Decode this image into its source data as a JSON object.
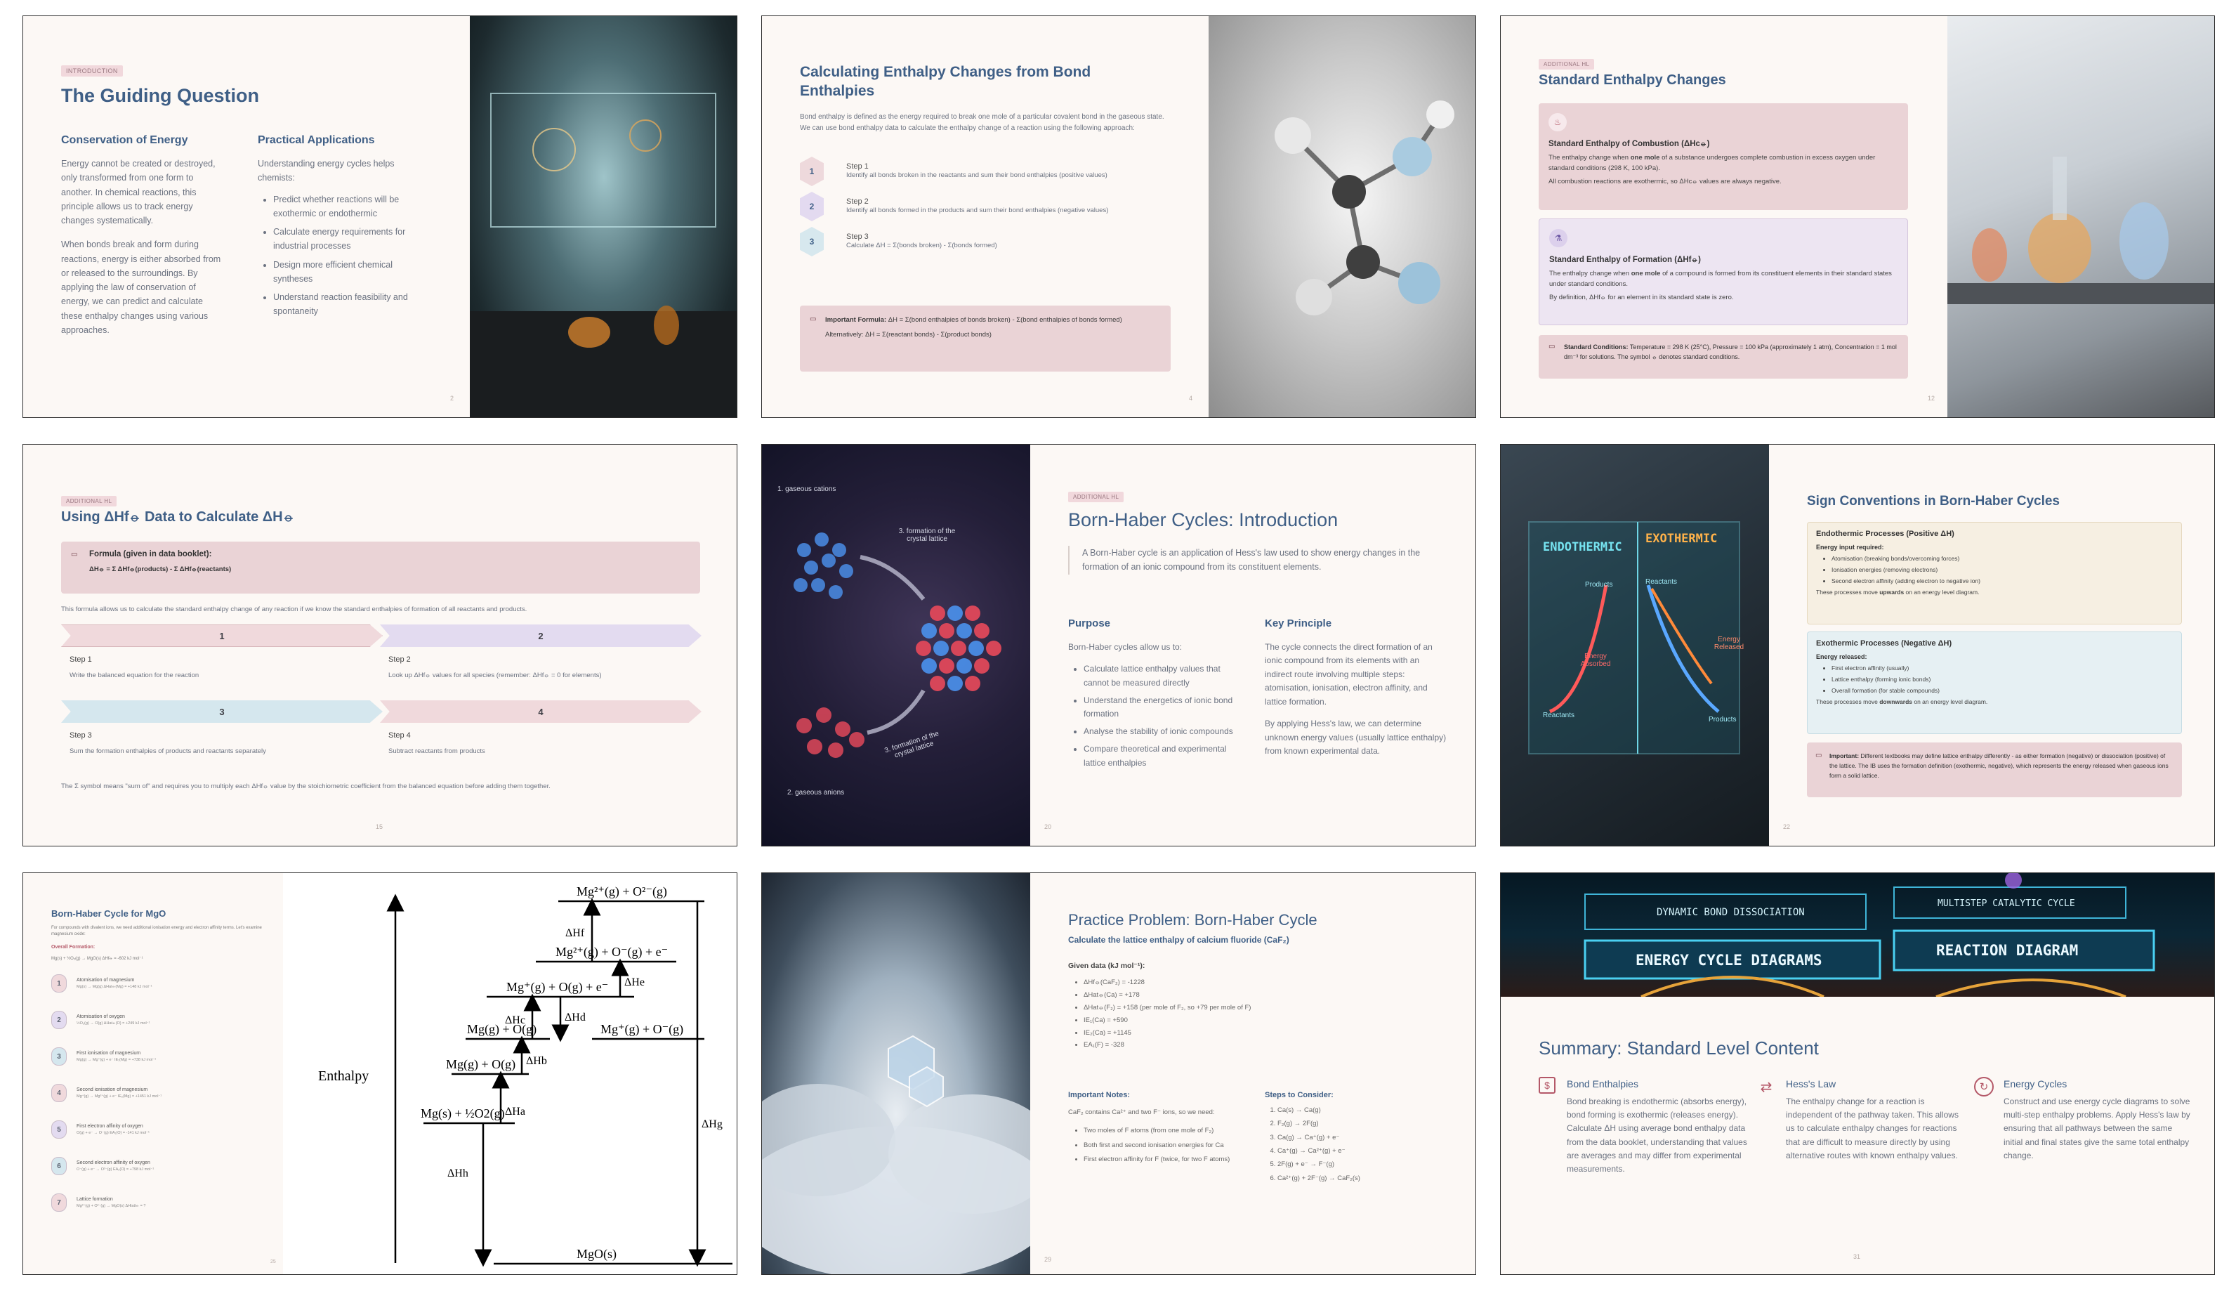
{
  "s2": {
    "tag": "INTRODUCTION",
    "title": "The Guiding Question",
    "col1_head": "Conservation of Energy",
    "col1_p1": "Energy cannot be created or destroyed, only transformed from one form to another. In chemical reactions, this principle allows us to track energy changes systematically.",
    "col1_p2": "When bonds break and form during reactions, energy is either absorbed from or released to the surroundings. By applying the law of conservation of energy, we can predict and calculate these enthalpy changes using various approaches.",
    "col2_head": "Practical Applications",
    "col2_intro": "Understanding energy cycles helps chemists:",
    "col2_items": [
      "Predict whether reactions will be exothermic or endothermic",
      "Calculate energy requirements for industrial processes",
      "Design more efficient chemical syntheses",
      "Understand reaction feasibility and spontaneity"
    ],
    "num": "2"
  },
  "s4": {
    "title": "Calculating Enthalpy Changes from Bond Enthalpies",
    "intro": "Bond enthalpy is defined as the energy required to break one mole of a particular covalent bond in the gaseous state. We can use bond enthalpy data to calculate the enthalpy change of a reaction using the following approach:",
    "steps": [
      {
        "n": "1",
        "label": "Step 1",
        "text": "Identify all bonds broken in the reactants and sum their bond enthalpies (positive values)"
      },
      {
        "n": "2",
        "label": "Step 2",
        "text": "Identify all bonds formed in the products and sum their bond enthalpies (negative values)"
      },
      {
        "n": "3",
        "label": "Step 3",
        "text": "Calculate ΔH = Σ(bonds broken) - Σ(bonds formed)"
      }
    ],
    "formula_b": "Important Formula:",
    "formula": "ΔH = Σ(bond enthalpies of bonds broken) - Σ(bond enthalpies of bonds formed)",
    "formula_alt": "Alternatively: ΔH = Σ(reactant bonds) - Σ(product bonds)",
    "num": "4"
  },
  "s12": {
    "tag": "ADDITIONAL HL",
    "title": "Standard Enthalpy Changes",
    "box1_head": "Standard Enthalpy of Combustion (ΔHc⦵)",
    "box1_p1a": "The enthalpy change when ",
    "box1_p1b": "one mole",
    "box1_p1c": " of a substance undergoes complete combustion in excess oxygen under standard conditions (298 K, 100 kPa).",
    "box1_p2": "All combustion reactions are exothermic, so ΔHc⦵ values are always negative.",
    "box2_head": "Standard Enthalpy of Formation (ΔHf⦵)",
    "box2_p1a": "The enthalpy change when ",
    "box2_p1b": "one mole",
    "box2_p1c": " of a compound is formed from its constituent elements in their standard states under standard conditions.",
    "box2_p2": "By definition, ΔHf⦵ for an element in its standard state is zero.",
    "cond_b": "Standard Conditions:",
    "cond": " Temperature = 298 K (25°C), Pressure = 100 kPa (approximately 1 atm), Concentration = 1 mol dm⁻³ for solutions. The symbol ⦵ denotes standard conditions.",
    "num": "12"
  },
  "s15": {
    "tag": "ADDITIONAL HL",
    "title": "Using ΔHf⦵ Data to Calculate ΔH⦵",
    "formula_head": "Formula (given in data booklet):",
    "formula": "ΔH⦵ = Σ ΔHf⦵(products) - Σ ΔHf⦵(reactants)",
    "intro": "This formula allows us to calculate the standard enthalpy change of any reaction if we know the standard enthalpies of formation of all reactants and products.",
    "steps": [
      {
        "n": "1",
        "label": "Step 1",
        "text": "Write the balanced equation for the reaction"
      },
      {
        "n": "2",
        "label": "Step 2",
        "text": "Look up ΔHf⦵ values for all species (remember: ΔHf⦵ = 0 for elements)"
      },
      {
        "n": "3",
        "label": "Step 3",
        "text": "Sum the formation enthalpies of products and reactants separately"
      },
      {
        "n": "4",
        "label": "Step 4",
        "text": "Subtract reactants from products"
      }
    ],
    "note": "The Σ symbol means \"sum of\" and requires you to multiply each ΔHf⦵ value by the stoichiometric coefficient from the balanced equation before adding them together.",
    "num": "15"
  },
  "s20": {
    "img_labels": [
      "1. gaseous cations",
      "3. formation of the crystal lattice",
      "3. formation of the crystal lattice",
      "2. gaseous anions"
    ],
    "tag": "ADDITIONAL HL",
    "title": "Born-Haber Cycles: Introduction",
    "quote": "A Born-Haber cycle is an application of Hess's law used to show energy changes in the formation of an ionic compound from its constituent elements.",
    "purpose_head": "Purpose",
    "purpose_intro": "Born-Haber cycles allow us to:",
    "purpose_items": [
      "Calculate lattice enthalpy values that cannot be measured directly",
      "Understand the energetics of ionic bond formation",
      "Analyse the stability of ionic compounds",
      "Compare theoretical and experimental lattice enthalpies"
    ],
    "key_head": "Key Principle",
    "key_p1": "The cycle connects the direct formation of an ionic compound from its elements with an indirect route involving multiple steps: atomisation, ionisation, electron affinity, and lattice formation.",
    "key_p2": "By applying Hess's law, we can determine unknown energy values (usually lattice enthalpy) from known experimental data.",
    "num": "20"
  },
  "s22": {
    "img_labels": [
      "ENDOTHERMIC",
      "EXOTHERMIC",
      "Products",
      "Reactants",
      "Reactants",
      "Energy Released",
      "Energy Absorbed",
      "Products"
    ],
    "title": "Sign Conventions in Born-Haber Cycles",
    "endo_head": "Endothermic Processes (Positive ΔH)",
    "endo_sub": "Energy input required:",
    "endo_items": [
      "Atomisation (breaking bonds/overcoming forces)",
      "Ionisation energies (removing electrons)",
      "Second electron affinity (adding electron to negative ion)"
    ],
    "endo_foot_a": "These processes move ",
    "endo_foot_b": "upwards",
    "endo_foot_c": " on an energy level diagram.",
    "exo_head": "Exothermic Processes (Negative ΔH)",
    "exo_sub": "Energy released:",
    "exo_items": [
      "First electron affinity (usually)",
      "Lattice enthalpy (forming ionic bonds)",
      "Overall formation (for stable compounds)"
    ],
    "exo_foot_a": "These processes move ",
    "exo_foot_b": "downwards",
    "exo_foot_c": " on an energy level diagram.",
    "imp_b": "Important:",
    "imp": " Different textbooks may define lattice enthalpy differently - as either formation (negative) or dissociation (positive) of the lattice. The IB uses the formation definition (exothermic, negative), which represents the energy released when gaseous ions form a solid lattice.",
    "num": "22"
  },
  "s25": {
    "title": "Born-Haber Cycle for MgO",
    "intro": "For compounds with divalent ions, we need additional ionisation energy and electron affinity terms. Let's examine magnesium oxide:",
    "overall_head": "Overall Formation:",
    "overall": "Mg(s) + ½O₂(g) → MgO(s) ΔHf⦵ = -602 kJ mol⁻¹",
    "steps": [
      {
        "n": "1",
        "head": "Atomisation of magnesium",
        "eq": "Mg(s) → Mg(g) ΔHat⦵(Mg) = +148 kJ mol⁻¹"
      },
      {
        "n": "2",
        "head": "Atomisation of oxygen",
        "eq": "½O₂(g) → O(g) ΔHat⦵(O) = +249 kJ mol⁻¹"
      },
      {
        "n": "3",
        "head": "First ionisation of magnesium",
        "eq": "Mg(g) → Mg⁺(g) + e⁻ IE₁(Mg) = +738 kJ mol⁻¹"
      },
      {
        "n": "4",
        "head": "Second ionisation of magnesium",
        "eq": "Mg⁺(g) → Mg²⁺(g) + e⁻ IE₂(Mg) = +1451 kJ mol⁻¹"
      },
      {
        "n": "5",
        "head": "First electron affinity of oxygen",
        "eq": "O(g) + e⁻ → O⁻(g) EA₁(O) = -141 kJ mol⁻¹"
      },
      {
        "n": "6",
        "head": "Second electron affinity of oxygen",
        "eq": "O⁻(g) + e⁻ → O²⁻(g) EA₂(O) = +798 kJ mol⁻¹"
      },
      {
        "n": "7",
        "head": "Lattice formation",
        "eq": "Mg²⁺(g) + O²⁻(g) → MgO(s) ΔHlatt⦵ = ?"
      }
    ],
    "diagram": {
      "axis": "Enthalpy",
      "levels": [
        "Mg²⁺(g) + O²⁻(g)",
        "Mg²⁺(g) + O⁻(g) + e⁻",
        "Mg⁺(g) + O(g) + e⁻",
        "Mg⁺(g) + O⁻(g)",
        "Mg(g) + O(g)",
        "Mg(g) + O(g)",
        "Mg(s) + ½O2(g)",
        "MgO(s)"
      ],
      "arrows": [
        "ΔHf",
        "ΔHe",
        "ΔHc",
        "ΔHd",
        "ΔHb",
        "ΔHa",
        "ΔHh",
        "ΔHg"
      ]
    },
    "num": "25"
  },
  "s29": {
    "title": "Practice Problem: Born-Haber Cycle",
    "subtitle": "Calculate the lattice enthalpy of calcium fluoride (CaF₂)",
    "given_head": "Given data (kJ mol⁻¹):",
    "given": [
      "ΔHf⦵(CaF₂) = -1228",
      "ΔHat⦵(Ca) = +178",
      "ΔHat⦵(F₂) = +158 (per mole of F₂, so +79 per mole of F)",
      "IE₁(Ca) = +590",
      "IE₂(Ca) = +1145",
      "EA₁(F) = -328"
    ],
    "notes_head": "Important Notes:",
    "notes_intro": "CaF₂ contains Ca²⁺ and two F⁻ ions, so we need:",
    "notes": [
      "Two moles of F atoms (from one mole of F₂)",
      "Both first and second ionisation energies for Ca",
      "First electron affinity for F (twice, for two F atoms)"
    ],
    "steps_head": "Steps to Consider:",
    "steps": [
      "Ca(s) → Ca(g)",
      "F₂(g) → 2F(g)",
      "Ca(g) → Ca⁺(g) + e⁻",
      "Ca⁺(g) → Ca²⁺(g) + e⁻",
      "2F(g) + e⁻ → F⁻(g)",
      "Ca²⁺(g) + 2F⁻(g) → CaF₂(s)"
    ],
    "num": "29"
  },
  "s31": {
    "img_labels": [
      "DYNAMIC BOND DISSOCIATION",
      "MULTISTEP CATALYTIC CYCLE",
      "ENERGY CYCLE DIAGRAMS",
      "REACTION DIAGRAM"
    ],
    "title": "Summary: Standard Level Content",
    "cols": [
      {
        "head": "Bond Enthalpies",
        "text": "Bond breaking is endothermic (absorbs energy), bond forming is exothermic (releases energy). Calculate ΔH using average bond enthalpy data from the data booklet, understanding that values are averages and may differ from experimental measurements."
      },
      {
        "head": "Hess's Law",
        "text": "The enthalpy change for a reaction is independent of the pathway taken. This allows us to calculate enthalpy changes for reactions that are difficult to measure directly by using alternative routes with known enthalpy values."
      },
      {
        "head": "Energy Cycles",
        "text": "Construct and use energy cycle diagrams to solve multi-step enthalpy problems. Apply Hess's law by ensuring that all pathways between the same initial and final states give the same total enthalpy change."
      }
    ],
    "num": "31"
  }
}
